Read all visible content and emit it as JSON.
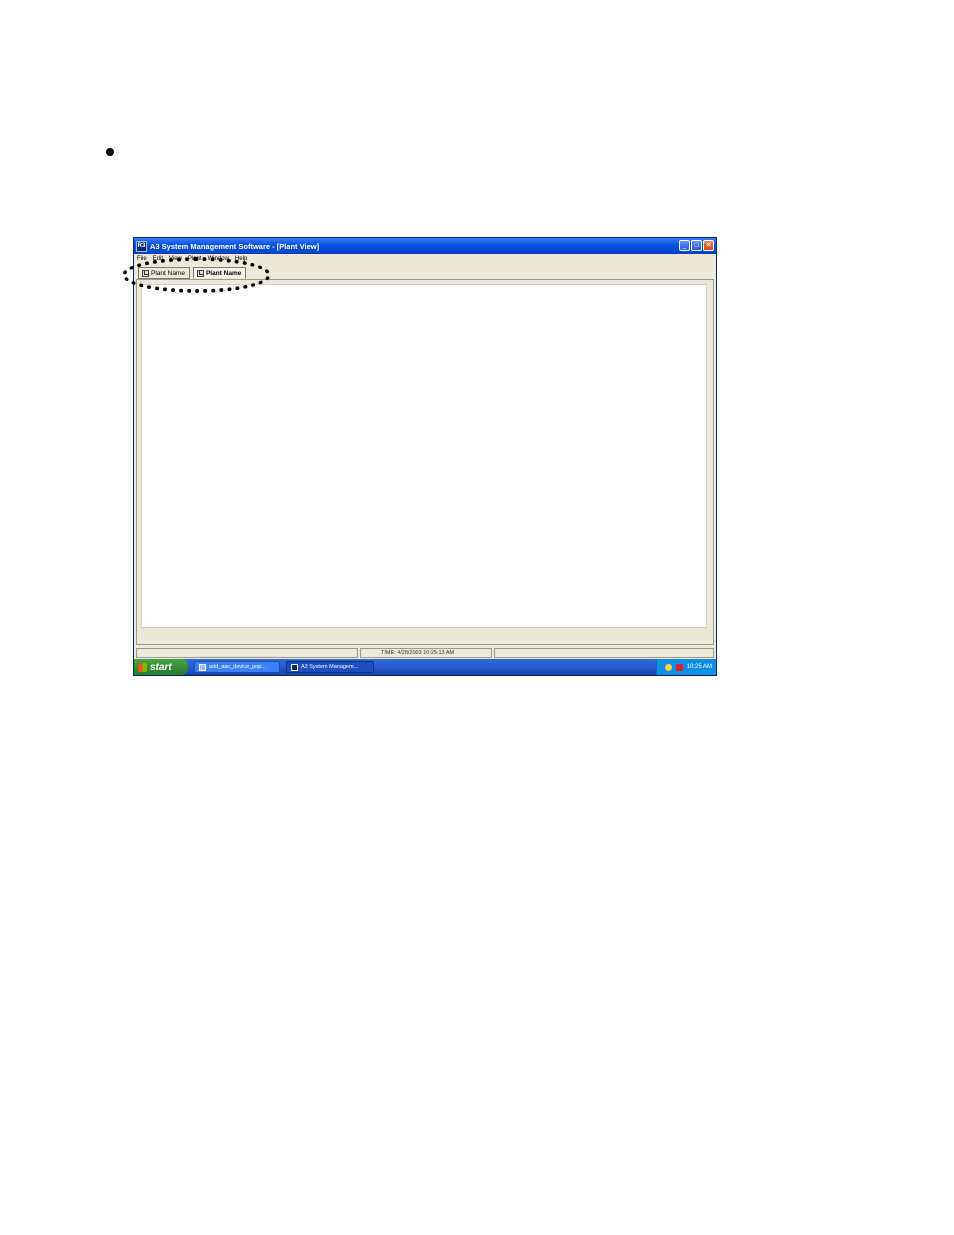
{
  "window": {
    "title": "A3 System Management Software - [Plant View]",
    "app_icon_text": "R3"
  },
  "menu": [
    "File",
    "Edit",
    "View",
    "Plant",
    "Window",
    "Help"
  ],
  "tabs": [
    {
      "label": "Plant Name",
      "active": false
    },
    {
      "label": "Plant Name",
      "active": true
    }
  ],
  "status": {
    "time_text": "TIME:  4/28/2003 10:25:13 AM"
  },
  "taskbar": {
    "start_label": "start",
    "tasks": [
      {
        "label": "add_aac_device_pop...",
        "active": false
      },
      {
        "label": "A3 System Managem...",
        "active": true
      }
    ],
    "clock": "10:25 AM"
  },
  "colors": {
    "titlebar": "#0a54e3",
    "window_bg": "#ece9d8",
    "taskbar": "#2a5bd0",
    "start_button": "#2f8b2f",
    "annotation": "#000000"
  }
}
